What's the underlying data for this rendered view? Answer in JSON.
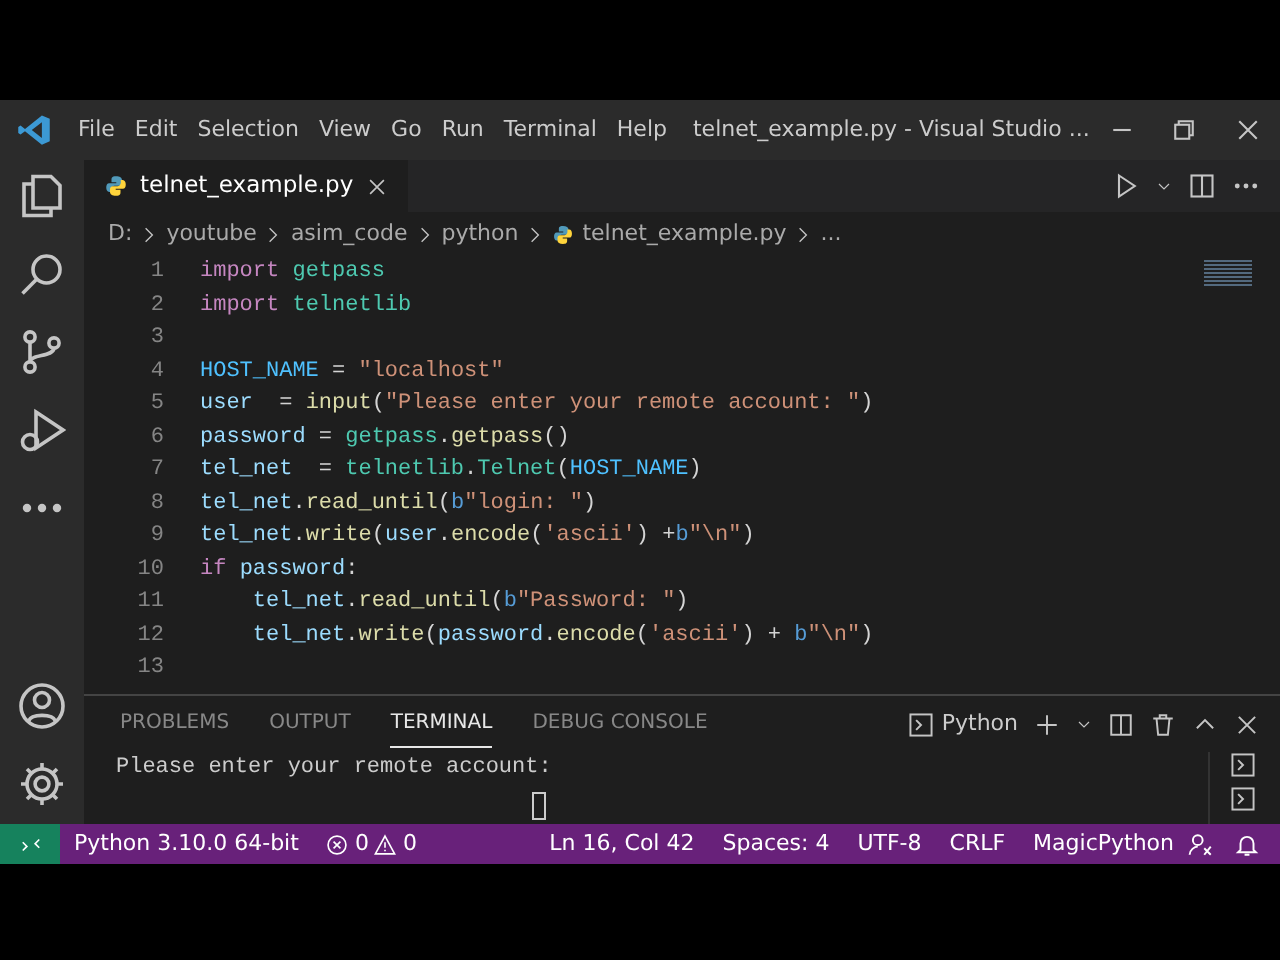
{
  "window": {
    "title": "telnet_example.py - Visual Studio ...",
    "menu": [
      "File",
      "Edit",
      "Selection",
      "View",
      "Go",
      "Run",
      "Terminal",
      "Help"
    ]
  },
  "tabs": [
    {
      "label": "telnet_example.py",
      "selected": true
    }
  ],
  "breadcrumbs": [
    {
      "kind": "folder",
      "label": "D:"
    },
    {
      "kind": "folder",
      "label": "youtube"
    },
    {
      "kind": "folder",
      "label": "asim_code"
    },
    {
      "kind": "folder",
      "label": "python"
    },
    {
      "kind": "file",
      "label": "telnet_example.py"
    },
    {
      "kind": "more",
      "label": "..."
    }
  ],
  "code": {
    "lines": [
      {
        "number": "1",
        "tokens": [
          {
            "kind": "keyword",
            "text": "import "
          },
          {
            "kind": "module",
            "text": "getpass"
          }
        ]
      },
      {
        "number": "2",
        "tokens": [
          {
            "kind": "keyword",
            "text": "import "
          },
          {
            "kind": "module",
            "text": "telnetlib"
          }
        ]
      },
      {
        "number": "3"
      },
      {
        "number": "4",
        "tokens": [
          {
            "kind": "constant",
            "text": "HOST_NAME"
          },
          {
            "kind": "plain",
            "text": " = "
          },
          {
            "kind": "string",
            "text": "\"localhost\""
          }
        ]
      },
      {
        "number": "5",
        "tokens": [
          {
            "kind": "variable",
            "text": "user"
          },
          {
            "kind": "plain",
            "text": "  = "
          },
          {
            "kind": "function",
            "text": "input"
          },
          {
            "kind": "plain",
            "text": "("
          },
          {
            "kind": "string",
            "text": "\"Please enter your remote account: \""
          },
          {
            "kind": "plain",
            "text": ")"
          }
        ]
      },
      {
        "number": "6",
        "tokens": [
          {
            "kind": "variable",
            "text": "password"
          },
          {
            "kind": "plain",
            "text": " = "
          },
          {
            "kind": "module",
            "text": "getpass"
          },
          {
            "kind": "plain",
            "text": "."
          },
          {
            "kind": "function",
            "text": "getpass"
          },
          {
            "kind": "plain",
            "text": "()"
          }
        ]
      },
      {
        "number": "7",
        "tokens": [
          {
            "kind": "variable",
            "text": "tel_net"
          },
          {
            "kind": "plain",
            "text": "  = "
          },
          {
            "kind": "module",
            "text": "telnetlib"
          },
          {
            "kind": "plain",
            "text": "."
          },
          {
            "kind": "module",
            "text": "Telnet"
          },
          {
            "kind": "plain",
            "text": "("
          },
          {
            "kind": "constant",
            "text": "HOST_NAME"
          },
          {
            "kind": "plain",
            "text": ")"
          }
        ]
      },
      {
        "number": "8",
        "tokens": [
          {
            "kind": "variable",
            "text": "tel_net"
          },
          {
            "kind": "plain",
            "text": "."
          },
          {
            "kind": "function",
            "text": "read_until"
          },
          {
            "kind": "plain",
            "text": "("
          },
          {
            "kind": "prefix",
            "text": "b"
          },
          {
            "kind": "string",
            "text": "\"login: \""
          },
          {
            "kind": "plain",
            "text": ")"
          }
        ]
      },
      {
        "number": "9",
        "tokens": [
          {
            "kind": "variable",
            "text": "tel_net"
          },
          {
            "kind": "plain",
            "text": "."
          },
          {
            "kind": "function",
            "text": "write"
          },
          {
            "kind": "plain",
            "text": "("
          },
          {
            "kind": "variable",
            "text": "user"
          },
          {
            "kind": "plain",
            "text": "."
          },
          {
            "kind": "function",
            "text": "encode"
          },
          {
            "kind": "plain",
            "text": "("
          },
          {
            "kind": "string",
            "text": "'ascii'"
          },
          {
            "kind": "plain",
            "text": ") +"
          },
          {
            "kind": "prefix",
            "text": "b"
          },
          {
            "kind": "string",
            "text": "\"\\n\""
          },
          {
            "kind": "plain",
            "text": ")"
          }
        ]
      },
      {
        "number": "10",
        "tokens": [
          {
            "kind": "keyword",
            "text": "if "
          },
          {
            "kind": "variable",
            "text": "password"
          },
          {
            "kind": "plain",
            "text": ":"
          }
        ],
        "children": [
          {
            "number": "11",
            "tokens": [
              {
                "kind": "variable",
                "text": "tel_net"
              },
              {
                "kind": "plain",
                "text": "."
              },
              {
                "kind": "function",
                "text": "read_until"
              },
              {
                "kind": "plain",
                "text": "("
              },
              {
                "kind": "prefix",
                "text": "b"
              },
              {
                "kind": "string",
                "text": "\"Password: \""
              },
              {
                "kind": "plain",
                "text": ")"
              }
            ]
          },
          {
            "number": "12",
            "tokens": [
              {
                "kind": "variable",
                "text": "tel_net"
              },
              {
                "kind": "plain",
                "text": "."
              },
              {
                "kind": "function",
                "text": "write"
              },
              {
                "kind": "plain",
                "text": "("
              },
              {
                "kind": "variable",
                "text": "password"
              },
              {
                "kind": "plain",
                "text": "."
              },
              {
                "kind": "function",
                "text": "encode"
              },
              {
                "kind": "plain",
                "text": "("
              },
              {
                "kind": "string",
                "text": "'ascii'"
              },
              {
                "kind": "plain",
                "text": ") + "
              },
              {
                "kind": "prefix",
                "text": "b"
              },
              {
                "kind": "string",
                "text": "\"\\n\""
              },
              {
                "kind": "plain",
                "text": ")"
              }
            ]
          }
        ]
      },
      {
        "number": "13"
      }
    ]
  },
  "panel": {
    "tabs": [
      {
        "label": "PROBLEMS",
        "selected": false
      },
      {
        "label": "OUTPUT",
        "selected": false
      },
      {
        "label": "TERMINAL",
        "selected": true
      },
      {
        "label": "DEBUG CONSOLE",
        "selected": false
      }
    ],
    "shell": "Python",
    "terminal_lines": [
      "Please enter your remote account:"
    ]
  },
  "status_bar": {
    "interpreter": "Python 3.10.0 64-bit",
    "errors": "0",
    "warnings": "0",
    "right": [
      "Ln 16, Col 42",
      "Spaces: 4",
      "UTF-8",
      "CRLF",
      "MagicPython"
    ]
  }
}
